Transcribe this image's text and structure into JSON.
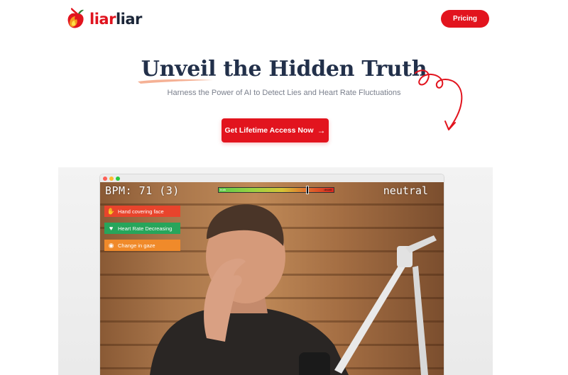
{
  "brand": {
    "name_part1": "liar",
    "name_part2": "liar",
    "primary_color": "#e2141e",
    "dark_color": "#1b2638"
  },
  "nav": {
    "pricing_label": "Pricing"
  },
  "hero": {
    "title_highlight": "Unveil",
    "title_rest": " the Hidden Truth",
    "subtitle": "Harness the Power of AI to Detect Lies and Heart Rate Fluctuations",
    "cta_label": "Get Lifetime Access Now",
    "cta_icon": "arrow-right-icon"
  },
  "demo": {
    "bpm_text": "BPM: 71 (3)",
    "emotion": "neutral",
    "meter": {
      "left_label": "truth",
      "right_label": "deceit",
      "level": 0.77
    },
    "cues": [
      {
        "label": "Hand covering face",
        "icon": "hand-icon",
        "color": "#e8442c"
      },
      {
        "label": "Heart Rate Decreasing",
        "icon": "heart-rate-icon",
        "color": "#27a55b"
      },
      {
        "label": "Change in gaze",
        "icon": "eye-icon",
        "color": "#f08a2a"
      }
    ]
  }
}
